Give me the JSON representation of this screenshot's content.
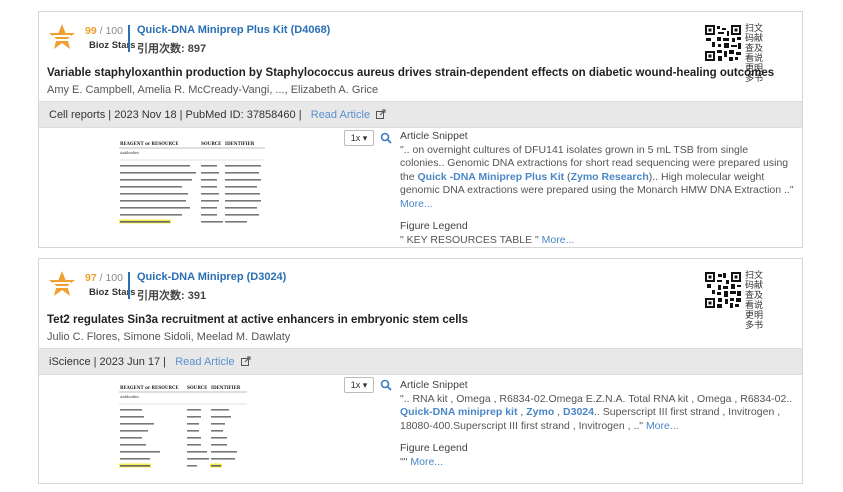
{
  "cards": [
    {
      "score": "99",
      "score_total": "/ 100",
      "bioz_label": "Bioz Stars",
      "product": "Quick-DNA Miniprep Plus Kit (D4068)",
      "citations": "引用次数: 897",
      "qr_caption": "扫文码献查及看说更明多书",
      "title": "Variable staphyloxanthin production by Staphylococcus aureus drives strain-dependent effects on diabetic wound-healing outcomes",
      "authors": "Amy E. Campbell, Amelia R. McCready-Vangi, ..., Elizabeth A. Grice",
      "meta": "Cell reports   |   2023 Nov 18   |   PubMed ID: 37858460   |",
      "read_article": "Read Article",
      "zoom": "1x ▾",
      "snippet_label": "Article Snippet",
      "snippet_pre": "\".. on overnight cultures of DFU141 isolates grown in 5 mL TSB from single colonies.. Genomic DNA extractions for short read sequencing were prepared using the ",
      "snippet_hl1": "Quick -DNA Miniprep Plus Kit",
      "snippet_mid": " (",
      "snippet_hl2": "Zymo Research",
      "snippet_post": ").. High molecular weight genomic DNA extractions were prepared using the Monarch HMW DNA Extraction ..\" ",
      "more": "More...",
      "legend_label": "Figure Legend",
      "legend_text": "\" KEY RESOURCES TABLE \" ",
      "legend_more": "More...",
      "thumb_headers": [
        "REAGENT or RESOURCE",
        "SOURCE",
        "IDENTIFIER"
      ],
      "thumb_sub": "Antibodies"
    },
    {
      "score": "97",
      "score_total": "/ 100",
      "bioz_label": "Bioz Stars",
      "product": "Quick-DNA Miniprep (D3024)",
      "citations": "引用次数: 391",
      "qr_caption": "扫文码献查及看说更明多书",
      "title": "Tet2 regulates Sin3a recruitment at active enhancers in embryonic stem cells",
      "authors": "Julio C. Flores, Simone Sidoli, Meelad M. Dawlaty",
      "meta": "iScience   |   2023 Jun 17   |",
      "read_article": "Read Article",
      "zoom": "1x ▾",
      "snippet_label": "Article Snippet",
      "snippet_pre": "\".. RNA kit , Omega , R6834-02.Omega E.Z.N.A. Total RNA kit , Omega , R6834-02.. ",
      "snippet_hl1": "Quick-DNA miniprep kit",
      "snippet_mid": " , ",
      "snippet_hl2": "Zymo",
      "snippet_mid2": " , ",
      "snippet_hl3": "D3024",
      "snippet_post": ".. Superscript III first strand , Invitrogen , 18080-400.Superscript III first strand , Invitrogen , ..\" ",
      "more": "More...",
      "legend_label": "Figure Legend",
      "legend_text": "\"\" ",
      "legend_more": "More...",
      "thumb_headers": [
        "REAGENT or RESOURCE",
        "SOURCE",
        "IDENTIFIER"
      ],
      "thumb_sub": "Antibodies"
    }
  ],
  "colors": {
    "accent": "#2b6fb3",
    "link": "#4a86c8",
    "star": "#f0a030",
    "bar": "#e8e8e8"
  }
}
